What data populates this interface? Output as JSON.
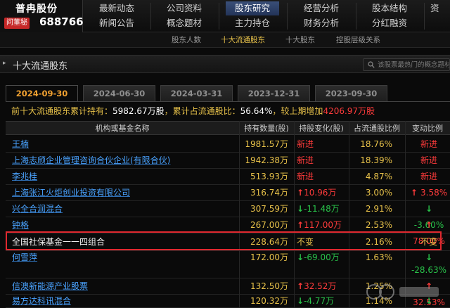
{
  "stock": {
    "name": "普冉股份",
    "ask_label": "问董秘",
    "code": "688766"
  },
  "nav": {
    "row1": [
      "最新动态",
      "公司资料",
      "股东研究",
      "经营分析",
      "股本结构",
      "资"
    ],
    "row2": [
      "新闻公告",
      "概念题材",
      "主力持仓",
      "财务分析",
      "分红融资"
    ],
    "active": "股东研究"
  },
  "subnav": [
    "股东人数",
    "十大流通股东",
    "十大股东",
    "控股层级关系"
  ],
  "section_title": "十大流通股东",
  "search": {
    "placeholder": "该股票最热门的概念题材"
  },
  "tabs": [
    "2024-09-30",
    "2024-06-30",
    "2024-03-31",
    "2023-12-31",
    "2023-09-30"
  ],
  "summary": {
    "prefix": "前十大流通股东累计持有：",
    "held": "5982.67万股",
    "ratio_label": "，累计占流通股比：",
    "ratio": "56.64%",
    "compare_label": "，较上期增加",
    "increase": "4206.97万股"
  },
  "table": {
    "headers": [
      "机构或基金名称",
      "持有数量(股)",
      "持股变化(股)",
      "占流通股比例",
      "变动比例"
    ],
    "rows": [
      {
        "name": "王楠",
        "hold": "1981.57万",
        "change": "新进",
        "change_dir": "new",
        "ratio": "18.76%",
        "pct": "新进",
        "pct_dir": "new"
      },
      {
        "name": "上海志颀企业管理咨询合伙企业(有限合伙)",
        "hold": "1942.38万",
        "change": "新进",
        "change_dir": "new",
        "ratio": "18.39%",
        "pct": "新进",
        "pct_dir": "new"
      },
      {
        "name": "李兆桂",
        "hold": "513.93万",
        "change": "新进",
        "change_dir": "new",
        "ratio": "4.87%",
        "pct": "新进",
        "pct_dir": "new"
      },
      {
        "name": "上海张江火炬创业投资有限公司",
        "hold": "316.74万",
        "change": "10.96万",
        "change_dir": "up",
        "ratio": "3.00%",
        "pct": "3.58%",
        "pct_dir": "up"
      },
      {
        "name": "兴全合润混合",
        "hold": "307.59万",
        "change": "-11.48万",
        "change_dir": "down",
        "ratio": "2.91%",
        "pct": "-3.60%",
        "pct_dir": "down"
      },
      {
        "name": "钟格",
        "hold": "267.00万",
        "change": "117.00万",
        "change_dir": "up",
        "ratio": "2.53%",
        "pct": "78.00%",
        "pct_dir": "up"
      },
      {
        "name": "全国社保基金一一四组合",
        "hold": "228.64万",
        "change": "不变",
        "change_dir": "same",
        "ratio": "2.16%",
        "pct": "不变",
        "pct_dir": "same"
      },
      {
        "name": "何雪萍",
        "hold": "172.00万",
        "change": "-69.00万",
        "change_dir": "down",
        "ratio": "1.63%",
        "pct": "-28.63%",
        "pct_dir": "down"
      },
      {
        "name": "信澳新能源产业股票",
        "hold": "132.50万",
        "change": "32.52万",
        "change_dir": "up",
        "ratio": "1.25%",
        "pct": "32.53%",
        "pct_dir": "up"
      },
      {
        "name": "易方达科讯混合",
        "hold": "120.32万",
        "change": "-4.77万",
        "change_dir": "down",
        "ratio": "1.14%",
        "pct": "-3.81%",
        "pct_dir": "down"
      }
    ]
  },
  "colors": {
    "accent": "#e8c24a",
    "up": "#ff3b3b",
    "down": "#29c24a",
    "link": "#4aa3ff",
    "highlight": "#e0282f"
  }
}
